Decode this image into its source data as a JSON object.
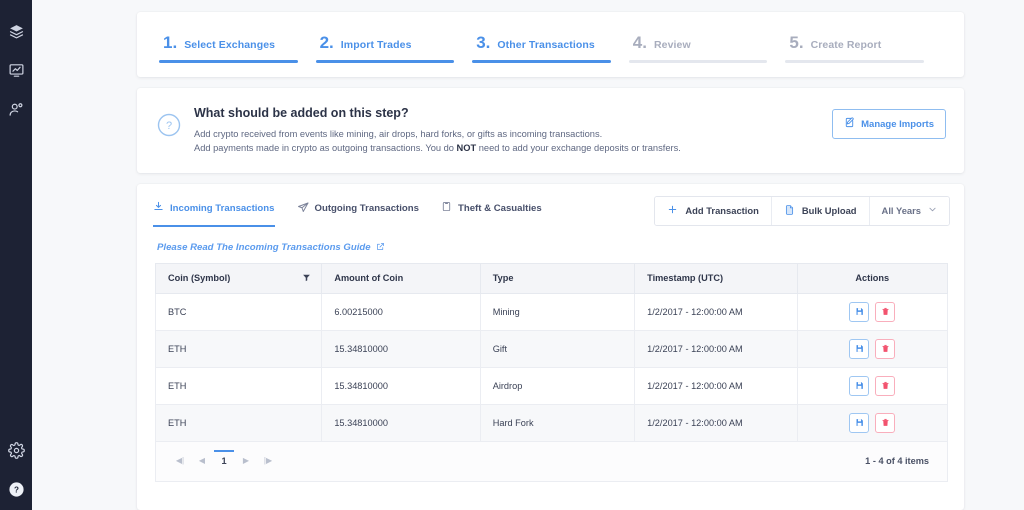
{
  "sidebar": {
    "top_items": [
      {
        "name": "layers-icon",
        "label": "Layers"
      },
      {
        "name": "chart-monitor-icon",
        "label": "Reports"
      },
      {
        "name": "user-settings-icon",
        "label": "Account"
      }
    ],
    "bottom_items": [
      {
        "name": "gear-icon",
        "label": "Settings"
      },
      {
        "name": "help-circle-icon",
        "label": "Help"
      }
    ]
  },
  "stepper": {
    "steps": [
      {
        "num": "1.",
        "label": "Select Exchanges",
        "active": true
      },
      {
        "num": "2.",
        "label": "Import Trades",
        "active": true
      },
      {
        "num": "3.",
        "label": "Other Transactions",
        "active": true
      },
      {
        "num": "4.",
        "label": "Review",
        "active": false
      },
      {
        "num": "5.",
        "label": "Create Report",
        "active": false
      }
    ]
  },
  "info": {
    "title": "What should be added on this step?",
    "line1": "Add crypto received from events like mining, air drops, hard forks, or gifts as incoming transactions.",
    "line2_a": "Add payments made in crypto as outgoing transactions. You do ",
    "line2_b": "NOT",
    "line2_c": " need to add your exchange deposits or transfers.",
    "manage_imports_label": "Manage Imports"
  },
  "tabs": [
    {
      "label": "Incoming Transactions",
      "icon": "download-icon",
      "active": true
    },
    {
      "label": "Outgoing Transactions",
      "icon": "send-icon",
      "active": false
    },
    {
      "label": "Theft & Casualties",
      "icon": "clipboard-icon",
      "active": false
    }
  ],
  "toolbar": {
    "add_transaction_label": "Add Transaction",
    "bulk_upload_label": "Bulk Upload",
    "year_filter_label": "All Years"
  },
  "guide_link": "Please Read The Incoming Transactions Guide",
  "table": {
    "columns": [
      "Coin (Symbol)",
      "Amount of Coin",
      "Type",
      "Timestamp (UTC)",
      "Actions"
    ],
    "rows": [
      {
        "coin": "BTC",
        "amount": "6.00215000",
        "type": "Mining",
        "timestamp": "1/2/2017 - 12:00:00 AM"
      },
      {
        "coin": "ETH",
        "amount": "15.34810000",
        "type": "Gift",
        "timestamp": "1/2/2017 - 12:00:00 AM"
      },
      {
        "coin": "ETH",
        "amount": "15.34810000",
        "type": "Airdrop",
        "timestamp": "1/2/2017 - 12:00:00 AM"
      },
      {
        "coin": "ETH",
        "amount": "15.34810000",
        "type": "Hard Fork",
        "timestamp": "1/2/2017 - 12:00:00 AM"
      }
    ]
  },
  "pagination": {
    "current_page": "1",
    "summary": "1 - 4 of 4 items"
  },
  "colors": {
    "accent_blue": "#4a90e8",
    "sidebar_bg": "#1d2234",
    "page_bg": "#f7f8fa",
    "danger_pink": "#f9aebc",
    "muted_gray": "#a8adbd"
  }
}
